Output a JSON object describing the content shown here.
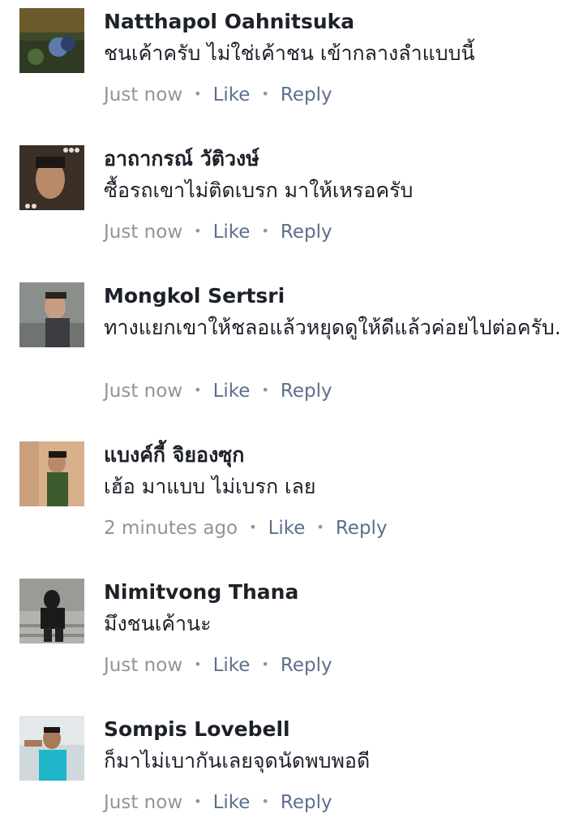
{
  "colors": {
    "name_text": "#1d2129",
    "body_text": "#1d2129",
    "timestamp": "#90949c",
    "action_link": "#5d6f8f"
  },
  "comments": [
    {
      "name": "Natthapol Oahnitsuka",
      "text": "ชนเค้าครับ ไม่ใช่เค้าชน เข้ากลางลำแบบนี้",
      "time": "Just now",
      "like": "Like",
      "reply": "Reply"
    },
    {
      "name": "อาถากรณ์ วัติวงษ์",
      "text": "ซื้อรถเขาไม่ติดเบรก มาให้เหรอครับ",
      "time": "Just now",
      "like": "Like",
      "reply": "Reply"
    },
    {
      "name": "Mongkol Sertsri",
      "text": "ทางแยกเขาให้ชลอแล้วหยุดดูให้ดีแล้วค่อยไปต่อครับ.",
      "time": "Just now",
      "like": "Like",
      "reply": "Reply"
    },
    {
      "name": "แบงค์กี้ จิยองซุก",
      "text": "เฮ้อ มาแบบ ไม่เบรก เลย",
      "time": "2 minutes ago",
      "like": "Like",
      "reply": "Reply"
    },
    {
      "name": "Nimitvong Thana",
      "text": "มึงชนเค้านะ",
      "time": "Just now",
      "like": "Like",
      "reply": "Reply"
    },
    {
      "name": "Sompis Lovebell",
      "text": "ก็มาไม่เบากันเลยจุดนัดพบพอดี",
      "time": "Just now",
      "like": "Like",
      "reply": "Reply"
    }
  ]
}
